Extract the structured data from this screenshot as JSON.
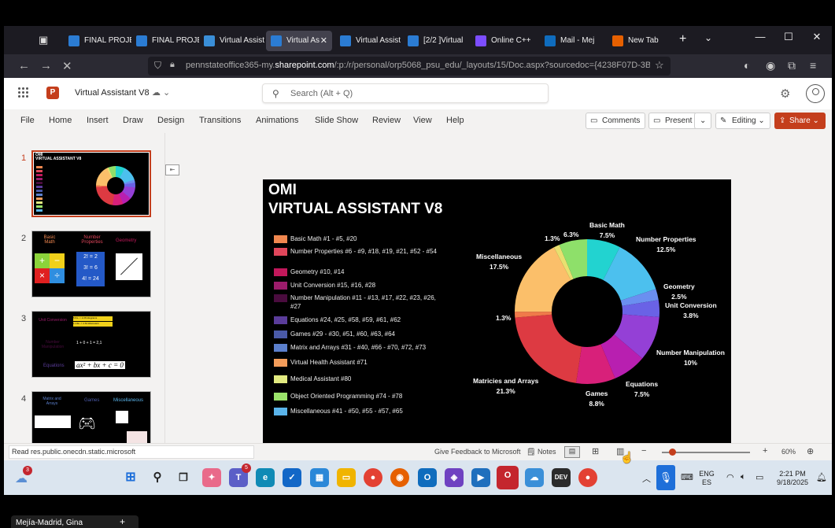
{
  "browser": {
    "tabs": [
      {
        "label": "FINAL PROJE",
        "icon": "word-icon",
        "active": false
      },
      {
        "label": "FINAL PROJE",
        "icon": "word-icon",
        "active": false
      },
      {
        "label": "Virtual Assist",
        "icon": "onedrive-icon",
        "active": false
      },
      {
        "label": "Virtual As",
        "icon": "loading-icon",
        "active": true
      },
      {
        "label": "Virtual Assist",
        "icon": "word-icon",
        "active": false
      },
      {
        "label": "[2/2 ]Virtual",
        "icon": "word-icon",
        "active": false
      },
      {
        "label": "Online C++",
        "icon": "compiler-icon",
        "active": false
      },
      {
        "label": "Mail - Mejía",
        "icon": "outlook-icon",
        "active": false
      },
      {
        "label": "New Tab",
        "icon": "firefox-icon",
        "active": false
      }
    ],
    "url_prefix": "pennstateoffice365-my.",
    "url_domain": "sharepoint.com",
    "url_suffix": "/:p:/r/personal/orp5068_psu_edu/_layouts/15/Doc.aspx?sourcedoc={4238F07D-3BC1-"
  },
  "app": {
    "doc_title": "Virtual Assistant V8",
    "search_placeholder": "Search (Alt + Q)",
    "menu": [
      "File",
      "Home",
      "Insert",
      "Draw",
      "Design",
      "Transitions",
      "Animations",
      "Slide Show",
      "Review",
      "View",
      "Help"
    ],
    "comments_label": "Comments",
    "present_label": "Present",
    "editing_label": "Editing",
    "share_label": "Share"
  },
  "thumbnails": [
    {
      "num": "1"
    },
    {
      "num": "2",
      "labels": [
        "Basic Math",
        "Number Properties",
        "Geometry"
      ],
      "math": [
        "2! = 2",
        "3! = 6",
        "4! = 24"
      ]
    },
    {
      "num": "3",
      "labels": [
        "Unit Conversion",
        "Number Manipulation",
        "Equations"
      ],
      "boxes": [
        "5 lbs -> 2.26 kilograms",
        "1 mile -> 1.61 kilometers"
      ],
      "formula": "ax² + bx + c = 0",
      "number": "1 + 0 + 1 = 2,1"
    },
    {
      "num": "4",
      "labels": [
        "Matrix and Arrays",
        "Games",
        "Miscellaneous"
      ]
    }
  ],
  "slide": {
    "company": "OMI",
    "title": "VIRTUAL ASSISTANT V8",
    "legend": [
      {
        "label": "Basic Math #1 - #5, #20",
        "color": "#f0874f"
      },
      {
        "label": "Number Properties #6 - #9, #18, #19, #21, #52 - #54",
        "color": "#e0465b"
      },
      {
        "label": "Geometry #10, #14",
        "color": "#c2185b"
      },
      {
        "label": "Unit Conversion #15, #16, #28",
        "color": "#9c1c6b"
      },
      {
        "label": "Number Manipulation #11 - #13, #17, #22, #23, #26, #27",
        "color": "#4a0c3e"
      },
      {
        "label": "Equations #24, #25, #58, #59, #61, #62",
        "color": "#5a3c9a"
      },
      {
        "label": "Games #29 - #30, #51, #60, #63, #64",
        "color": "#4a5aa8"
      },
      {
        "label": "Matrix and Arrays #31 - #40, #66 - #70, #72, #73",
        "color": "#5b7fcc"
      },
      {
        "label": "Virtual Health Assistant #71",
        "color": "#f39c5a"
      },
      {
        "label": "Medical Assistant #80",
        "color": "#e2ea80"
      },
      {
        "label": "Object Oriented Programming #74 - #78",
        "color": "#9be36a"
      },
      {
        "label": "Miscellaneous #41 - #50, #55 - #57, #65",
        "color": "#5ab4ea"
      }
    ]
  },
  "chart_data": {
    "type": "pie",
    "donut": true,
    "slices": [
      {
        "label": "Basic Math",
        "value": 7.5,
        "value_text": "7.5%",
        "color": "#22d3d0"
      },
      {
        "label": "Number Properties",
        "value": 12.5,
        "value_text": "12.5%",
        "color": "#4cc0ee"
      },
      {
        "label": "Geometry",
        "value": 2.5,
        "value_text": "2.5%",
        "color": "#6a8ff0"
      },
      {
        "label": "Unit Conversion",
        "value": 3.8,
        "value_text": "3.8%",
        "color": "#6a62e6"
      },
      {
        "label": "Number Manipulation",
        "value": 10,
        "value_text": "10%",
        "color": "#9440d6"
      },
      {
        "label": "Equations",
        "value": 7.5,
        "value_text": "7.5%",
        "color": "#b81fb0"
      },
      {
        "label": "Games",
        "value": 8.8,
        "value_text": "8.8%",
        "color": "#d8207a"
      },
      {
        "label": "Matricies and Arrays",
        "value": 21.3,
        "value_text": "21.3%",
        "color": "#dd3a42"
      },
      {
        "label": "",
        "value": 1.3,
        "value_text": "1.3%",
        "color": "#f07a4a"
      },
      {
        "label": "Miscellaneous",
        "value": 17.5,
        "value_text": "17.5%",
        "color": "#fbbf6a"
      },
      {
        "label": "",
        "value": 1.3,
        "value_text": "1.3%",
        "color": "#e8e070"
      },
      {
        "label": "",
        "value": 6.3,
        "value_text": "6.3%",
        "color": "#8ee06a"
      }
    ]
  },
  "statusbar": {
    "message": "Read res.public.onecdn.static.microsoft",
    "feedback": "Give Feedback to Microsoft",
    "notes": "Notes",
    "zoom": "60%",
    "zoom_fraction": 0.12
  },
  "taskbar": {
    "weather_badge": "3",
    "teams_badge": "5",
    "lang_top": "ENG",
    "lang_bottom": "ES",
    "time": "2:21 PM",
    "date": "9/18/2025"
  },
  "bottom_tab": {
    "label": "Mejía-Madrid, Gina"
  }
}
